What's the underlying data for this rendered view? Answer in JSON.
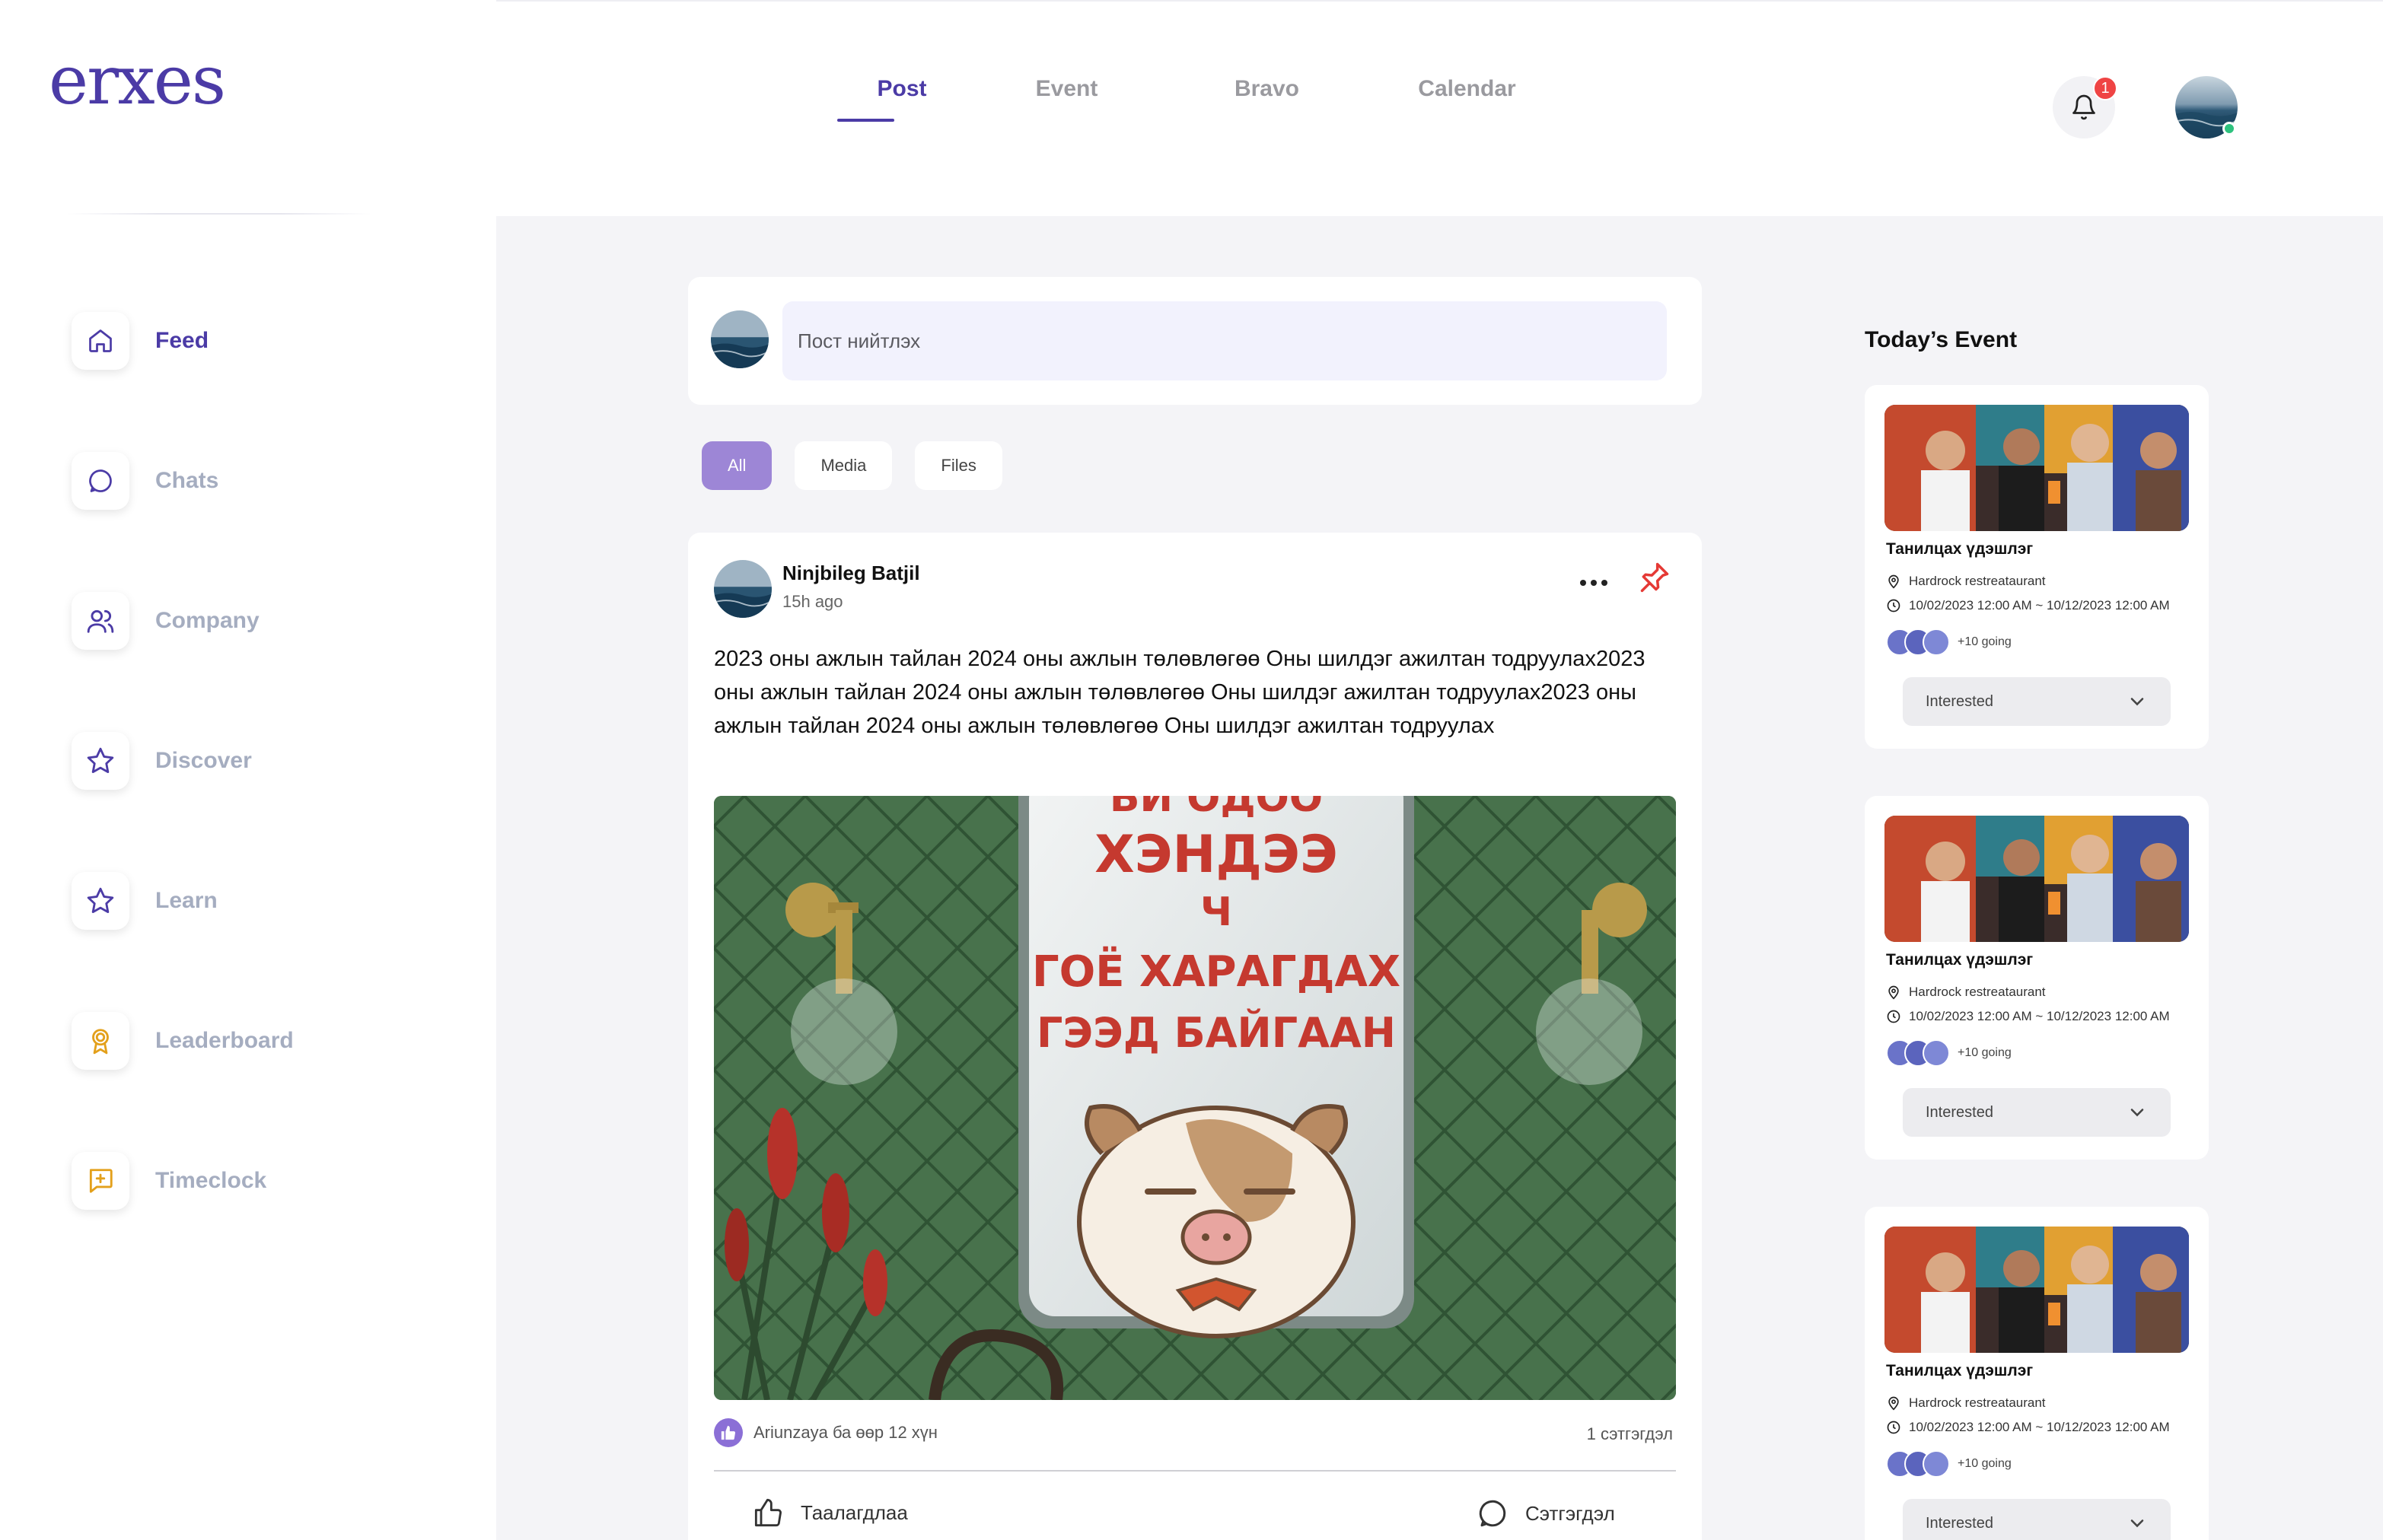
{
  "app": {
    "logo_text": "erxes"
  },
  "header": {
    "tabs": [
      {
        "label": "Post",
        "active": true
      },
      {
        "label": "Event",
        "active": false
      },
      {
        "label": "Bravo",
        "active": false
      },
      {
        "label": "Calendar",
        "active": false
      }
    ],
    "notification_count": "1"
  },
  "sidebar": {
    "items": [
      {
        "label": "Feed",
        "icon": "home-icon",
        "active": true
      },
      {
        "label": "Chats",
        "icon": "chat-icon",
        "active": false
      },
      {
        "label": "Company",
        "icon": "users-icon",
        "active": false
      },
      {
        "label": "Discover",
        "icon": "star-icon",
        "active": false
      },
      {
        "label": "Learn",
        "icon": "star-icon",
        "active": false
      },
      {
        "label": "Leaderboard",
        "icon": "award-icon",
        "active": false
      },
      {
        "label": "Timeclock",
        "icon": "message-plus-icon",
        "active": false
      }
    ]
  },
  "composer": {
    "placeholder": "Пост нийтлэх"
  },
  "filters": [
    {
      "label": "All",
      "active": true
    },
    {
      "label": "Media",
      "active": false
    },
    {
      "label": "Files",
      "active": false
    }
  ],
  "post": {
    "author": "Ninjbileg Batjil",
    "time": "15h ago",
    "text": "2023 оны ажлын тайлан 2024 оны ажлын төлөвлөгөө Оны шилдэг ажилтан тодруулах2023 оны ажлын тайлан 2024 оны ажлын төлөвлөгөө Оны шилдэг ажилтан тодруулах2023 оны ажлын тайлан 2024 оны ажлын төлөвлөгөө Оны шилдэг ажилтан тодруулах",
    "image_text": {
      "line1": "БИ ОДОО",
      "line2": "ХЭНДЭЭ",
      "line3": "Ч",
      "line4": "ГОЁ ХАРАГДАХ",
      "line5": "ГЭЭД БАЙГААН"
    },
    "reactions_text": "Ariunzaya ба өөр 12 хүн",
    "comments_text": "1 сэтгэгдэл",
    "like_label": "Таалагдлаа",
    "comment_label": "Сэтгэгдэл"
  },
  "events": {
    "title": "Today’s Event",
    "items": [
      {
        "name": "Танилцах үдэшлэг",
        "location": "Hardrock restreataurant",
        "time": "10/02/2023 12:00 AM ~ 10/12/2023 12:00 AM",
        "going": "+10 going",
        "button": "Interested"
      },
      {
        "name": "Танилцах үдэшлэг",
        "location": "Hardrock restreataurant",
        "time": "10/02/2023 12:00 AM ~ 10/12/2023 12:00 AM",
        "going": "+10 going",
        "button": "Interested"
      },
      {
        "name": "Танилцах үдэшлэг",
        "location": "Hardrock restreataurant",
        "time": "10/02/2023 12:00 AM ~ 10/12/2023 12:00 AM",
        "going": "+10 going",
        "button": "Interested"
      }
    ]
  },
  "colors": {
    "brand": "#4b3ba6",
    "accent": "#9d86d6",
    "badge": "#ef4444",
    "leaderboard_icon": "#e3a01b"
  }
}
